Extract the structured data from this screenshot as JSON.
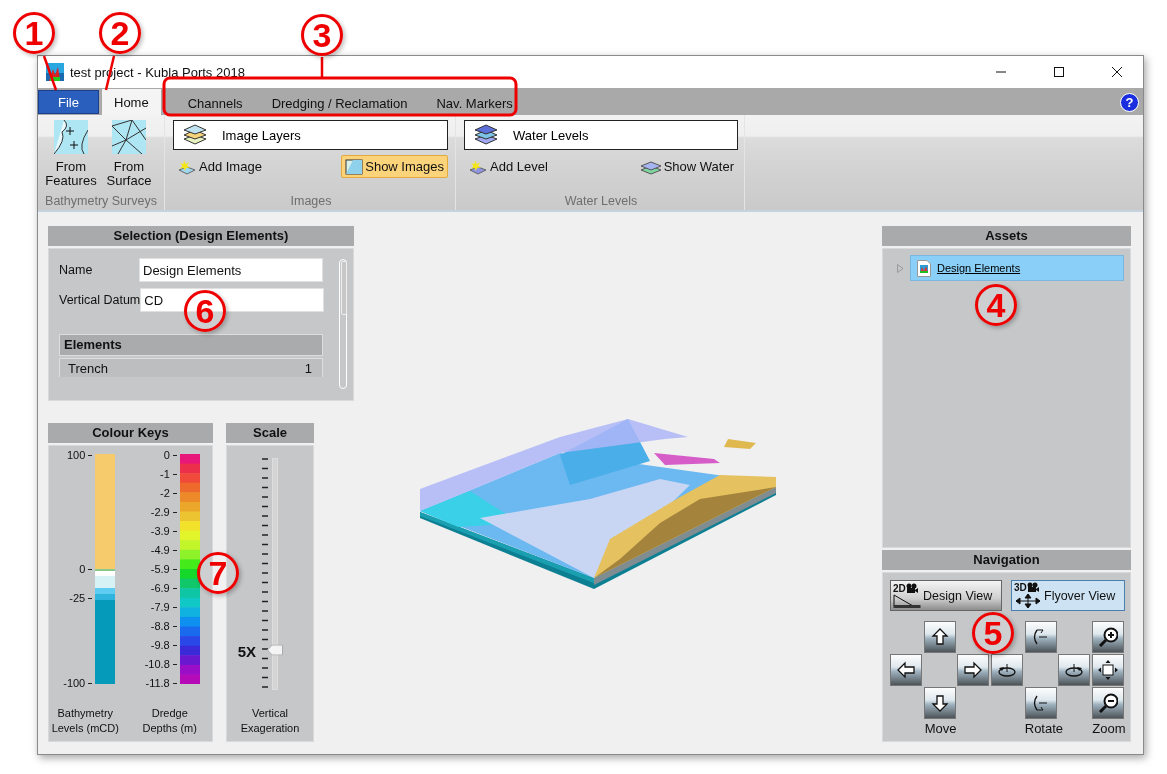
{
  "window": {
    "title": "test project - Kubla Ports 2018"
  },
  "ribbon_tabs": [
    {
      "label": "File",
      "kind": "file",
      "selected": false
    },
    {
      "label": "Home",
      "kind": "tab",
      "selected": true
    },
    {
      "label": "Channels",
      "kind": "tab",
      "selected": false
    },
    {
      "label": "Dredging / Reclamation",
      "kind": "tab",
      "selected": false
    },
    {
      "label": "Nav. Markers",
      "kind": "tab",
      "selected": false
    }
  ],
  "help_button": "?",
  "ribbon_groups": [
    {
      "label": "Bathymetry Surveys",
      "kind": "large",
      "buttons": [
        {
          "label": "From Features"
        },
        {
          "label": "From Surface"
        }
      ]
    },
    {
      "label": "Images",
      "kind": "layers",
      "dropdown": "Image Layers",
      "actions": [
        {
          "label": "Add Image",
          "kind": "button"
        },
        {
          "label": "Show Images",
          "kind": "toggle",
          "on": true
        }
      ]
    },
    {
      "label": "Water Levels",
      "kind": "layers",
      "dropdown": "Water Levels",
      "actions": [
        {
          "label": "Add Level",
          "kind": "button"
        },
        {
          "label": "Show Water",
          "kind": "toggle",
          "on": false
        }
      ]
    }
  ],
  "selection": {
    "title": "Selection (Design Elements)",
    "fields": [
      {
        "label": "Name",
        "value": "Design Elements"
      },
      {
        "label": "Vertical Datum",
        "value": "CD"
      }
    ],
    "elements_header": "Elements",
    "rows": [
      {
        "name": "Trench",
        "count": "1"
      }
    ]
  },
  "colour_keys": {
    "title": "Colour Keys",
    "bathymetry": {
      "ticks": [
        "100",
        "0",
        "-25",
        "-100"
      ],
      "caption": "Bathymetry Levels (mCD)"
    },
    "dredge": {
      "ticks": [
        "0",
        "-1",
        "-2",
        "-2.9",
        "-3.9",
        "-4.9",
        "-5.9",
        "-6.9",
        "-7.9",
        "-8.8",
        "-9.8",
        "-10.8",
        "-11.8"
      ],
      "caption": "Dredge Depths (m)"
    }
  },
  "scale": {
    "title": "Scale",
    "value_label": "5X",
    "level": 0.17,
    "caption": "Vertical Exageration"
  },
  "assets": {
    "title": "Assets",
    "items": [
      {
        "label": "Design Elements",
        "selected": true,
        "expanded": false
      }
    ]
  },
  "navigation": {
    "title": "Navigation",
    "views": [
      {
        "badge": "2D",
        "label": "Design View",
        "selected": false
      },
      {
        "badge": "3D",
        "label": "Flyover View",
        "selected": true
      }
    ],
    "group_labels": [
      "Move",
      "Rotate",
      "Zoom"
    ]
  },
  "callouts": [
    {
      "number": "1"
    },
    {
      "number": "2"
    },
    {
      "number": "3"
    },
    {
      "number": "4"
    },
    {
      "number": "5"
    },
    {
      "number": "6"
    },
    {
      "number": "7"
    }
  ]
}
